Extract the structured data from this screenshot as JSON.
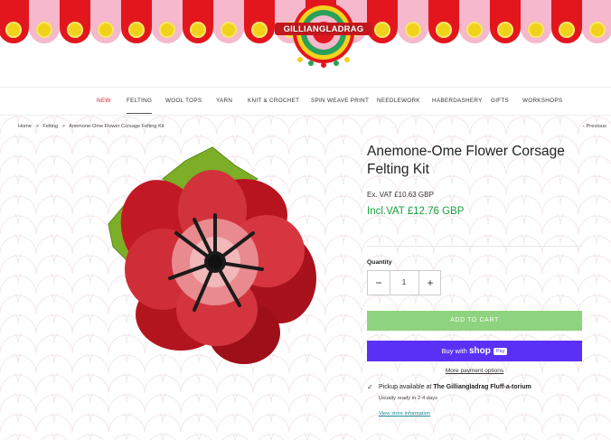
{
  "logo": {
    "text": "GILLIANGLADRAG"
  },
  "nav": {
    "items": [
      {
        "label": "NEW",
        "state": "active"
      },
      {
        "label": "FELTING",
        "state": "selected"
      },
      {
        "label": "WOOL TOPS",
        "state": ""
      },
      {
        "label": "YARN",
        "state": ""
      },
      {
        "label": "KNIT & CROCHET",
        "state": ""
      },
      {
        "label": "SPIN WEAVE PRINT",
        "state": ""
      },
      {
        "label": "NEEDLEWORK",
        "state": ""
      },
      {
        "label": "HABERDASHERY",
        "state": ""
      },
      {
        "label": "GIFTS",
        "state": ""
      },
      {
        "label": "WORKSHOPS",
        "state": ""
      }
    ]
  },
  "breadcrumb": {
    "home": "Home",
    "category": "Felting",
    "current": "Anemone-Ome Flower Corsage Felting Kit",
    "separator": ">"
  },
  "previous": {
    "label": "Previous",
    "icon": "chevron-left-icon"
  },
  "product": {
    "title": "Anemone-Ome Flower Corsage Felting Kit",
    "ex_vat": "Ex. VAT  £10.63 GBP",
    "inc_vat": "Incl.VAT  £12.76 GBP",
    "quantity_label": "Quantity",
    "quantity_value": "1",
    "minus": "−",
    "plus": "+",
    "add_to_cart": "ADD TO CART",
    "buy_with": "Buy with",
    "shop": "shop",
    "pay": "Pay",
    "more_payment": "More payment options",
    "pickup_prefix": "Pickup available at",
    "pickup_store": "The Gilliangladrag Fluff-a-torium",
    "ready": "Usually ready in 2-4 days",
    "view_store": "View store information",
    "check_icon": "✓"
  },
  "colors": {
    "awning_red": "#e3161e",
    "awning_pink": "#f5b8cc",
    "price_green": "#18a23e",
    "add_cart_green": "#8ed37f",
    "shop_pay_purple": "#5a31f4"
  }
}
